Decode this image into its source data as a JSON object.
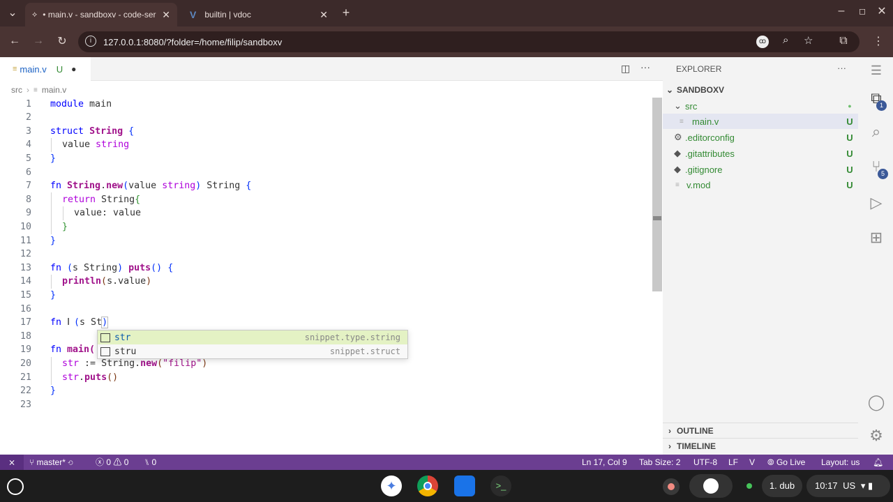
{
  "browser": {
    "tabs": [
      {
        "title": "• main.v - sandboxv - code-ser",
        "active": true
      },
      {
        "title": "builtin | vdoc",
        "active": false
      }
    ],
    "url": "127.0.0.1:8080/?folder=/home/filip/sandboxv",
    "profile_initials": "ꝏ"
  },
  "editor": {
    "tab": {
      "filename": "main.v",
      "status": "U"
    },
    "breadcrumb": [
      "src",
      "main.v"
    ],
    "lines": [
      "1",
      "2",
      "3",
      "4",
      "5",
      "6",
      "7",
      "8",
      "9",
      "10",
      "11",
      "12",
      "13",
      "14",
      "15",
      "16",
      "17",
      "18",
      "19",
      "20",
      "21",
      "22",
      "23"
    ],
    "code": {
      "l1a": "module",
      "l1b": " main",
      "l3a": "struct",
      "l3b": "String",
      "l3c": "{",
      "l4a": "value",
      "l4b": "string",
      "l5": "}",
      "l7a": "fn",
      "l7b": "String",
      "l7c": ".",
      "l7d": "new",
      "l7e": "(",
      "l7f": "value",
      "l7g": "string",
      "l7h": ")",
      "l7i": " String ",
      "l7j": "{",
      "l8a": "return",
      "l8b": " String",
      "l8c": "{",
      "l9": "value: value",
      "l10": "}",
      "l11": "}",
      "l13a": "fn",
      "l13b": "(",
      "l13c": "s String",
      "l13d": ")",
      "l13e": "puts",
      "l13f": "()",
      "l13g": "{",
      "l14a": "println",
      "l14b": "(",
      "l14c": "s.value",
      "l14d": ")",
      "l15": "}",
      "l17a": "fn",
      "l17b": "(",
      "l17c": "s St",
      "l17d": ")",
      "l19a": "fn",
      "l19b": "main(",
      "l20a": "str",
      "l20b": " := ",
      "l20c": "String",
      "l20d": ".",
      "l20e": "new",
      "l20f": "(",
      "l20g": "\"filip\"",
      "l20h": ")",
      "l21a": "str",
      "l21b": ".",
      "l21c": "puts",
      "l21d": "()",
      "l22": "}"
    },
    "suggestions": [
      {
        "label": "str",
        "detail": "snippet.type.string"
      },
      {
        "label": "stru",
        "detail": "snippet.struct"
      }
    ]
  },
  "explorer": {
    "title": "EXPLORER",
    "workspace": "SANDBOXV",
    "items": [
      {
        "label": "src",
        "badge": ""
      },
      {
        "label": "main.v",
        "badge": "U"
      },
      {
        "label": ".editorconfig",
        "badge": "U"
      },
      {
        "label": ".gitattributes",
        "badge": "U"
      },
      {
        "label": ".gitignore",
        "badge": "U"
      },
      {
        "label": "v.mod",
        "badge": "U"
      }
    ],
    "outline": "OUTLINE",
    "timeline": "TIMELINE",
    "more": "···"
  },
  "activity_badges": {
    "explorer": "1",
    "scm": "5"
  },
  "statusbar": {
    "branch": "master*",
    "errors": "0",
    "warnings": "0",
    "ports": "0",
    "position": "Ln 17, Col 9",
    "tab_size": "Tab Size: 2",
    "encoding": "UTF-8",
    "eol": "LF",
    "language": "V",
    "golive": "Go Live",
    "layout": "Layout: us"
  },
  "taskbar": {
    "window": "1. dub",
    "time": "10:17",
    "locale": "US"
  }
}
